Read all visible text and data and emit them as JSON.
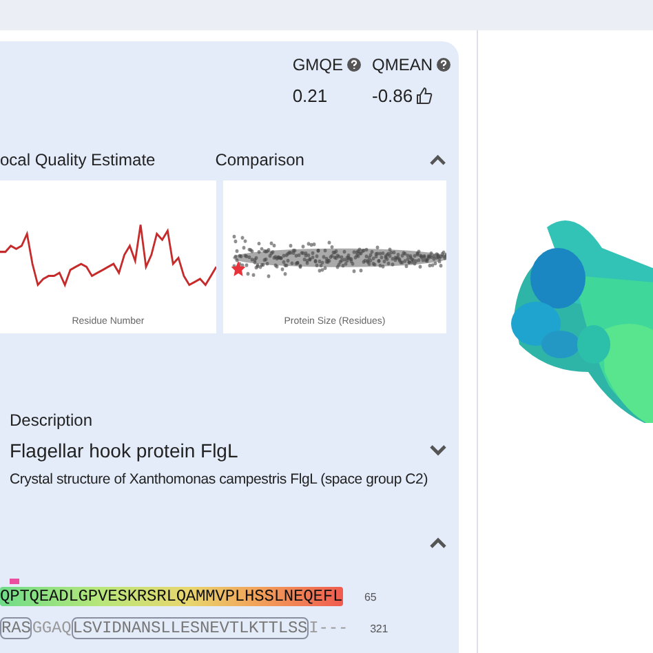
{
  "scores": [
    {
      "label": "GMQE",
      "value": "0.21",
      "thumb": false
    },
    {
      "label": "QMEAN",
      "value": "-0.86",
      "thumb": true
    }
  ],
  "quality_section": {
    "titles": [
      "ocal Quality Estimate",
      "Comparison"
    ],
    "expanded": true,
    "plots": [
      {
        "kind": "line",
        "xlabel": "Residue Number"
      },
      {
        "kind": "scatter",
        "xlabel": "Protein Size (Residues)"
      }
    ]
  },
  "description": {
    "heading": "Description",
    "title": "Flagellar hook protein FlgL",
    "text": "Crystal structure of Xanthomonas campestris FlgL (space group C2)",
    "expanded": false
  },
  "alignment": {
    "expanded": true,
    "rows": [
      {
        "kind": "target",
        "segments": [
          {
            "text": "QPTQEADLGPVESKRSRLQAMMVPLHSSLNEQEFL",
            "boxed": false
          }
        ],
        "number": "65"
      },
      {
        "kind": "template",
        "segments": [
          {
            "text": "RAS",
            "boxed": true
          },
          {
            "text": "GGAQ",
            "boxed": false
          },
          {
            "text": "LSVIDNANSLLESNEVTLKTTLSS",
            "boxed": true
          },
          {
            "text": "I---",
            "boxed": false
          }
        ],
        "number": "321"
      }
    ]
  }
}
